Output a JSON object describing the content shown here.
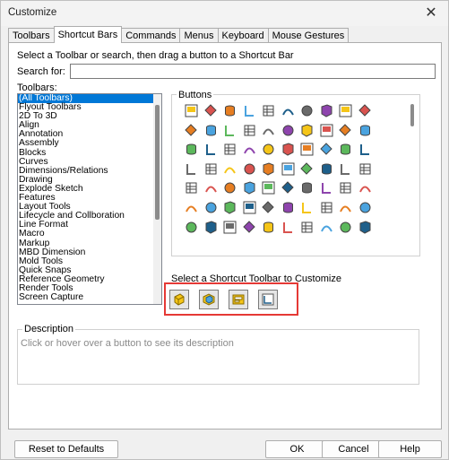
{
  "window": {
    "title": "Customize",
    "close_glyph": "✕"
  },
  "tabs": [
    {
      "label": "Toolbars",
      "active": false
    },
    {
      "label": "Shortcut Bars",
      "active": true
    },
    {
      "label": "Commands",
      "active": false
    },
    {
      "label": "Menus",
      "active": false
    },
    {
      "label": "Keyboard",
      "active": false
    },
    {
      "label": "Mouse Gestures",
      "active": false
    }
  ],
  "instruction": "Select a Toolbar or search, then drag a button to a Shortcut Bar",
  "search": {
    "label": "Search for:",
    "value": ""
  },
  "toolbars": {
    "label": "Toolbars:",
    "items": [
      "(All Toolbars)",
      "Flyout Toolbars",
      "2D To 3D",
      "Align",
      "Annotation",
      "Assembly",
      "Blocks",
      "Curves",
      "Dimensions/Relations",
      "Drawing",
      "Explode Sketch",
      "Features",
      "Layout Tools",
      "Lifecycle and Collboration",
      "Line Format",
      "Macro",
      "Markup",
      "MBD Dimension",
      "Mold Tools",
      "Quick Snaps",
      "Reference Geometry",
      "Render Tools",
      "Screen Capture"
    ],
    "selected_index": 0
  },
  "buttons_panel": {
    "label": "Buttons",
    "icons": [
      "insert-picture-icon",
      "note-list-icon",
      "text-icon",
      "pushpin-icon",
      "image-icon",
      "spline-icon",
      "axis-icon",
      "folder-image-icon",
      "chain-link-icon",
      "layout-icon",
      "part-icon",
      "table-icon",
      "grid-icon",
      "align-icon",
      "save-icon",
      "cylinder-icon",
      "camera-icon",
      "box-icon",
      "pen-icon",
      "table-small-icon",
      "assembly-icon",
      "color-cube-icon",
      "corner-icon",
      "stack-icon",
      "ring-icon",
      "curve-icon",
      "pie-icon",
      "magnet-icon",
      "funnel-icon",
      "table-grid-icon",
      "toolbox-icon",
      "magnify-icon",
      "globe-icon",
      "document-icon",
      "arrow-curve-icon",
      "printer-icon",
      "scanner-icon",
      "gear-icon",
      "bracket-icon",
      "line-icon",
      "hook-icon",
      "sweep-icon",
      "cube-icon",
      "circle-icon",
      "cut-icon",
      "gear-small-icon",
      "block-icon",
      "tree-icon",
      "flag-icon",
      "drum-icon",
      "eye-icon",
      "text-a-icon",
      "monitor-icon",
      "dimension-icon",
      "pins-icon",
      "hand-icon",
      "cylinder-small-icon",
      "color-ball-icon",
      "chart-icon",
      "stripes-icon",
      "key-icon",
      "ruler-icon",
      "shapes-icon",
      "picture-icon",
      "image2-icon",
      "bookmark-icon",
      "buildings-icon",
      "home-icon",
      "arrow-down-icon",
      "drawing-icon"
    ]
  },
  "shortcut_section": {
    "label": "Select a Shortcut Toolbar to Customize",
    "buttons": [
      {
        "name": "part-shortcut-icon"
      },
      {
        "name": "assembly-shortcut-icon"
      },
      {
        "name": "drawing-shortcut-icon"
      },
      {
        "name": "sketch-shortcut-icon"
      }
    ]
  },
  "description": {
    "label": "Description",
    "placeholder": "Click or hover over a button to see its description"
  },
  "footer": {
    "reset_label": "Reset to Defaults",
    "ok_label": "OK",
    "cancel_label": "Cancel",
    "help_label": "Help"
  },
  "colors": {
    "selection": "#0078d7",
    "highlight": "#e53935"
  }
}
